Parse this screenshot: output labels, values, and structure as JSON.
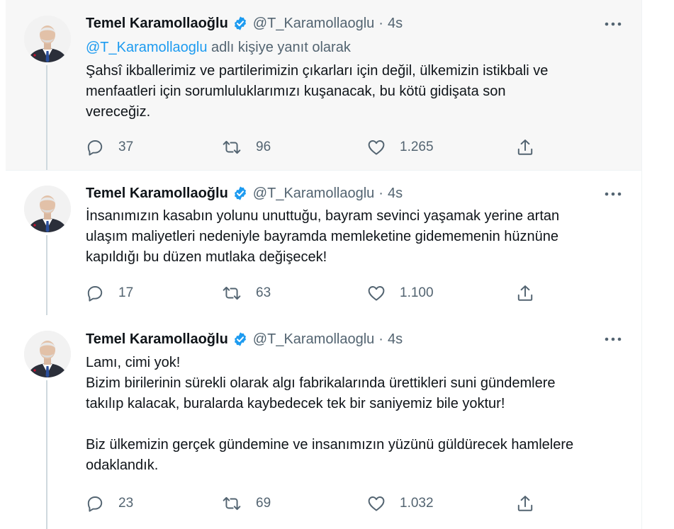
{
  "colors": {
    "accent": "#1d9bf0",
    "secondary_text": "#536471",
    "primary_text": "#0f1419"
  },
  "tweets": [
    {
      "author_name": "Temel Karamollaoğlu",
      "handle": "@T_Karamollaoglu",
      "separator": "·",
      "time": "4s",
      "verified_icon": "verified-badge-icon",
      "reply_context": {
        "mention": "@T_Karamollaoglu",
        "suffix": " adlı kişiye yanıt olarak"
      },
      "text": "Şahsî ikballerimiz ve partilerimizin çıkarları için değil, ülkemizin istikbali ve\nmenfaatleri için sorumluluklarımızı kuşanacak, bu kötü gidişata son\nvereceğiz.",
      "replies": "37",
      "retweets": "96",
      "likes": "1.265"
    },
    {
      "author_name": "Temel Karamollaoğlu",
      "handle": "@T_Karamollaoglu",
      "separator": "·",
      "time": "4s",
      "verified_icon": "verified-badge-icon",
      "text": "İnsanımızın kasabın yolunu unuttuğu, bayram sevinci yaşamak yerine artan\nulaşım maliyetleri nedeniyle bayramda memleketine gidememenin hüznüne\nkapıldığı bu düzen mutlaka değişecek!",
      "replies": "17",
      "retweets": "63",
      "likes": "1.100"
    },
    {
      "author_name": "Temel Karamollaoğlu",
      "handle": "@T_Karamollaoglu",
      "separator": "·",
      "time": "4s",
      "verified_icon": "verified-badge-icon",
      "text": "Lamı, cimi yok!\nBizim birilerinin sürekli olarak algı fabrikalarında ürettikleri suni gündemlere\ntakılıp kalacak, buralarda kaybedecek tek bir saniyemiz bile yoktur!\n\nBiz ülkemizin gerçek gündemine ve insanımızın yüzünü güldürecek hamlelere\nodaklandık.",
      "replies": "23",
      "retweets": "69",
      "likes": "1.032"
    }
  ]
}
